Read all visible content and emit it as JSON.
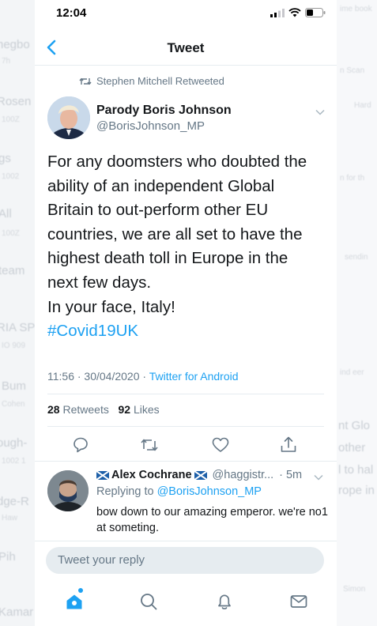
{
  "status": {
    "time": "12:04"
  },
  "header": {
    "title": "Tweet"
  },
  "context": {
    "retweeted_by": "Stephen Mitchell Retweeted"
  },
  "tweet": {
    "author_name": "Parody Boris Johnson",
    "author_handle": "@BorisJohnson_MP",
    "lines": [
      "For any doomsters who doubted the",
      "ability of an independent Global",
      "Britain to out-perform other EU",
      "countries, we are all set to have the",
      "highest death toll in Europe in the",
      "next few days.",
      "In your face, Italy!"
    ],
    "hashtag": "#Covid19UK",
    "timestamp": "11:56 · 30/04/2020 · ",
    "source": "Twitter for Android",
    "retweets_count": "28",
    "retweets_label": "Retweets",
    "likes_count": "92",
    "likes_label": "Likes"
  },
  "reply": {
    "name": "Alex Cochrane",
    "handle": "@haggistr...",
    "age": "· 5m",
    "replying_prefix": "Replying to ",
    "replying_to": "@BorisJohnson_MP",
    "text": "bow down to our amazing emperor. we're no1 at someting."
  },
  "composer": {
    "placeholder": "Tweet your reply"
  },
  "background": {
    "left": [
      "negbo",
      "Rosen",
      "gs",
      "All",
      "team",
      "RIA SP",
      "Bum",
      "ough-",
      "dge-R",
      "Pih",
      "Kamar"
    ],
    "left_sub": [
      "7h",
      "100Z",
      "1002",
      "100Z",
      "",
      "IO 909",
      "Cohen",
      "1002 1",
      "Haw",
      "",
      ""
    ],
    "right": [
      "ime book",
      "n Scan",
      "Hard",
      "n for th",
      "sendin",
      "ind eer",
      "nt Glo",
      "other",
      "l to hal",
      "rope in",
      "Simon"
    ]
  },
  "colors": {
    "accent": "#1da1f2",
    "muted": "#657786",
    "text": "#14171a",
    "divider": "#e6ecf0"
  },
  "icons": {
    "back": "chevron-left-icon",
    "retweet": "retweet-icon",
    "caret": "chevron-down-icon",
    "reply": "reply-icon",
    "like": "heart-icon",
    "share": "share-icon",
    "home": "home-icon",
    "search": "search-icon",
    "notifications": "bell-icon",
    "messages": "mail-icon"
  }
}
